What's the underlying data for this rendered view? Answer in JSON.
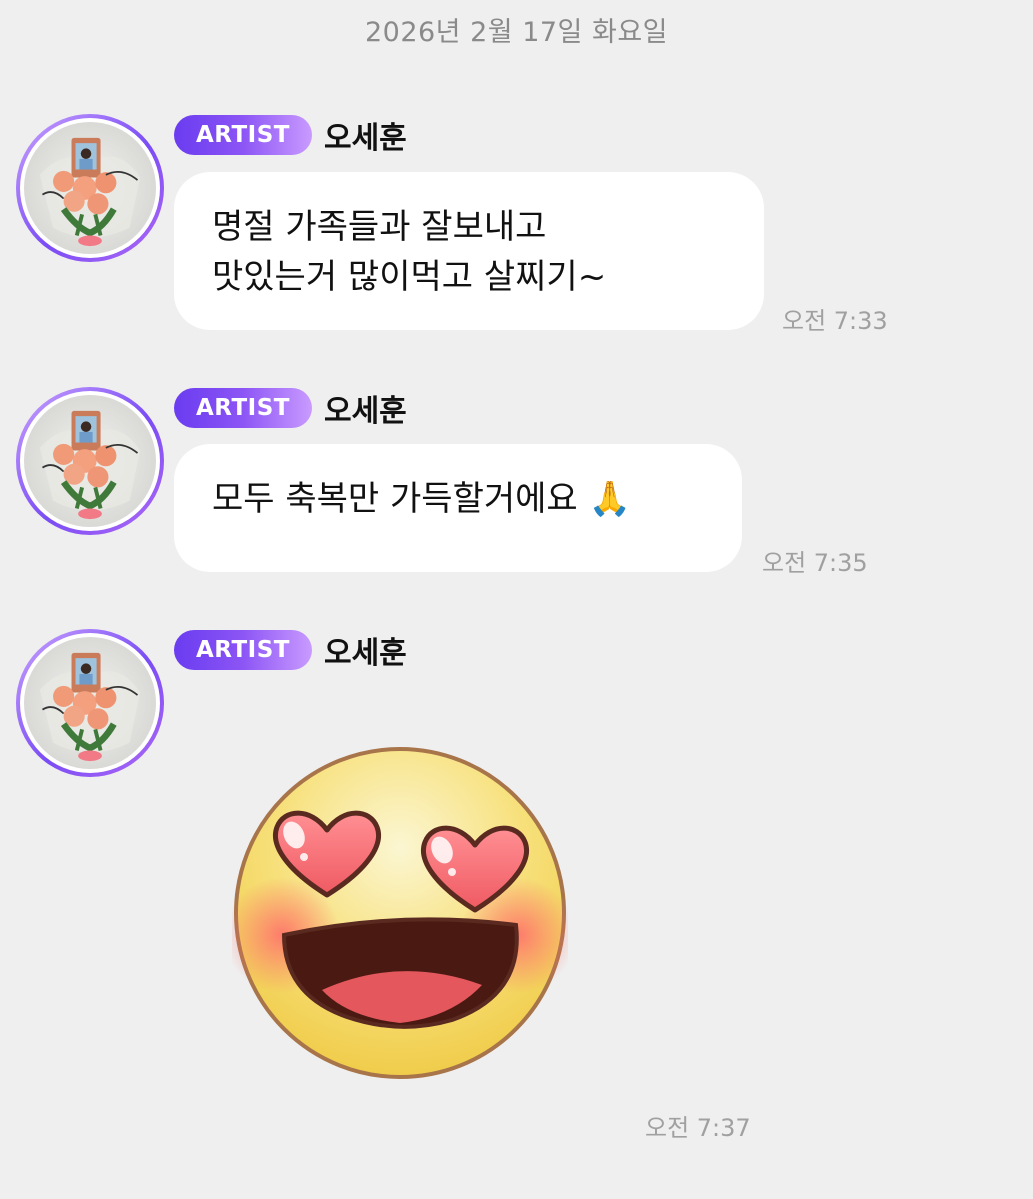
{
  "date_divider": "2026년 2월 17일 화요일",
  "messages": [
    {
      "badge": "ARTIST",
      "sender": "오세훈",
      "lines": [
        "명절 가족들과 잘보내고",
        "맛있는거 많이먹고 살찌기~"
      ],
      "time": "오전 7:33"
    },
    {
      "badge": "ARTIST",
      "sender": "오세훈",
      "text": "모두 축복만 가득할거에요 🙏",
      "time": "오전 7:35"
    },
    {
      "badge": "ARTIST",
      "sender": "오세훈",
      "sticker": "heart-eyes-smiley-sticker",
      "time": "오전 7:37"
    }
  ],
  "colors": {
    "background": "#efefef",
    "badge_gradient_start": "#6a3cf0",
    "badge_gradient_end": "#c99bff",
    "bubble": "#ffffff",
    "timestamp": "#a0a0a0"
  }
}
